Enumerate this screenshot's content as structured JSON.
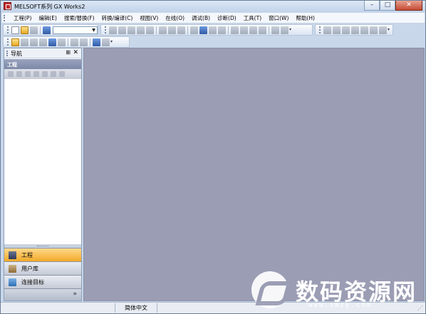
{
  "window": {
    "title": "MELSOFT系列 GX Works2"
  },
  "titlebar_buttons": {
    "minimize": "–",
    "maximize": "□",
    "close": "✕"
  },
  "menu": [
    {
      "label": "工程(P)"
    },
    {
      "label": "编辑(E)"
    },
    {
      "label": "搜索/替换(F)"
    },
    {
      "label": "转换/编译(C)"
    },
    {
      "label": "视图(V)"
    },
    {
      "label": "在线(O)"
    },
    {
      "label": "调试(B)"
    },
    {
      "label": "诊断(D)"
    },
    {
      "label": "工具(T)"
    },
    {
      "label": "窗口(W)"
    },
    {
      "label": "帮助(H)"
    }
  ],
  "navigation": {
    "title": "导航",
    "pin": "⊞",
    "close": "✕",
    "section_header": "工程",
    "bottom_buttons": [
      {
        "label": "工程",
        "active": true
      },
      {
        "label": "用户库",
        "active": false
      },
      {
        "label": "连接目标",
        "active": false
      }
    ],
    "expand": "»"
  },
  "statusbar": {
    "language": "简体中文",
    "grip": "⋰"
  },
  "watermark": {
    "text": "数码资源网",
    "url": "www.smzy.com"
  },
  "colors": {
    "workspace": "#9b9db4",
    "active_nav_button": "#f3a928",
    "section_header": "#7d88a8"
  }
}
